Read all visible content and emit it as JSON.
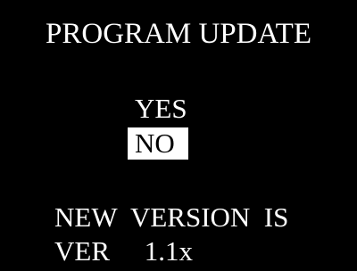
{
  "screen": {
    "title": "PROGRAM UPDATE",
    "options": [
      {
        "label": "YES",
        "selected": false
      },
      {
        "label": "NO",
        "selected": true
      }
    ],
    "message_line1": "NEW  VERSION  IS",
    "message_line2": "VER     1.1x"
  },
  "colors": {
    "background": "#000000",
    "text": "#ffffff",
    "highlight_bg": "#ffffff",
    "highlight_text": "#000000"
  }
}
